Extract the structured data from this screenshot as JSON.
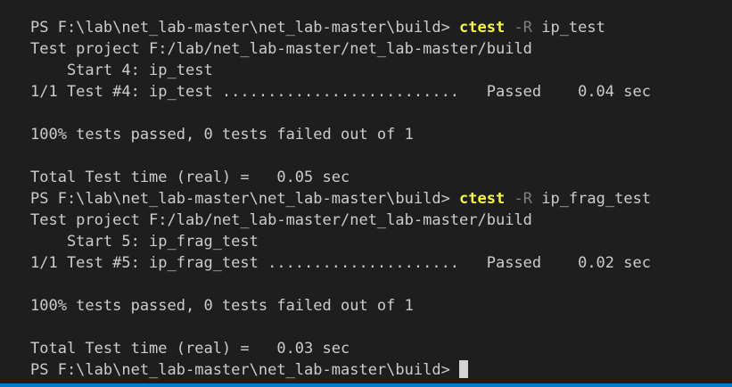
{
  "terminal": {
    "prompt": "PS F:\\lab\\net_lab-master\\net_lab-master\\build> ",
    "run1": {
      "cmd": "ctest",
      "flag": "-R",
      "arg": "ip_test",
      "project": "Test project F:/lab/net_lab-master/net_lab-master/build",
      "start": "    Start 4: ip_test",
      "result": "1/1 Test #4: ip_test ..........................   Passed    0.04 sec",
      "summary": "100% tests passed, 0 tests failed out of 1",
      "time": "Total Test time (real) =   0.05 sec"
    },
    "run2": {
      "cmd": "ctest",
      "flag": "-R",
      "arg": "ip_frag_test",
      "project": "Test project F:/lab/net_lab-master/net_lab-master/build",
      "start": "    Start 5: ip_frag_test",
      "result": "1/1 Test #5: ip_frag_test .....................   Passed    0.02 sec",
      "summary": "100% tests passed, 0 tests failed out of 1",
      "time": "Total Test time (real) =   0.03 sec"
    }
  },
  "colors": {
    "background": "#1e1e1e",
    "text": "#cccccc",
    "command": "#f5f543",
    "flag": "#808080",
    "accent_bar": "#007acc"
  }
}
